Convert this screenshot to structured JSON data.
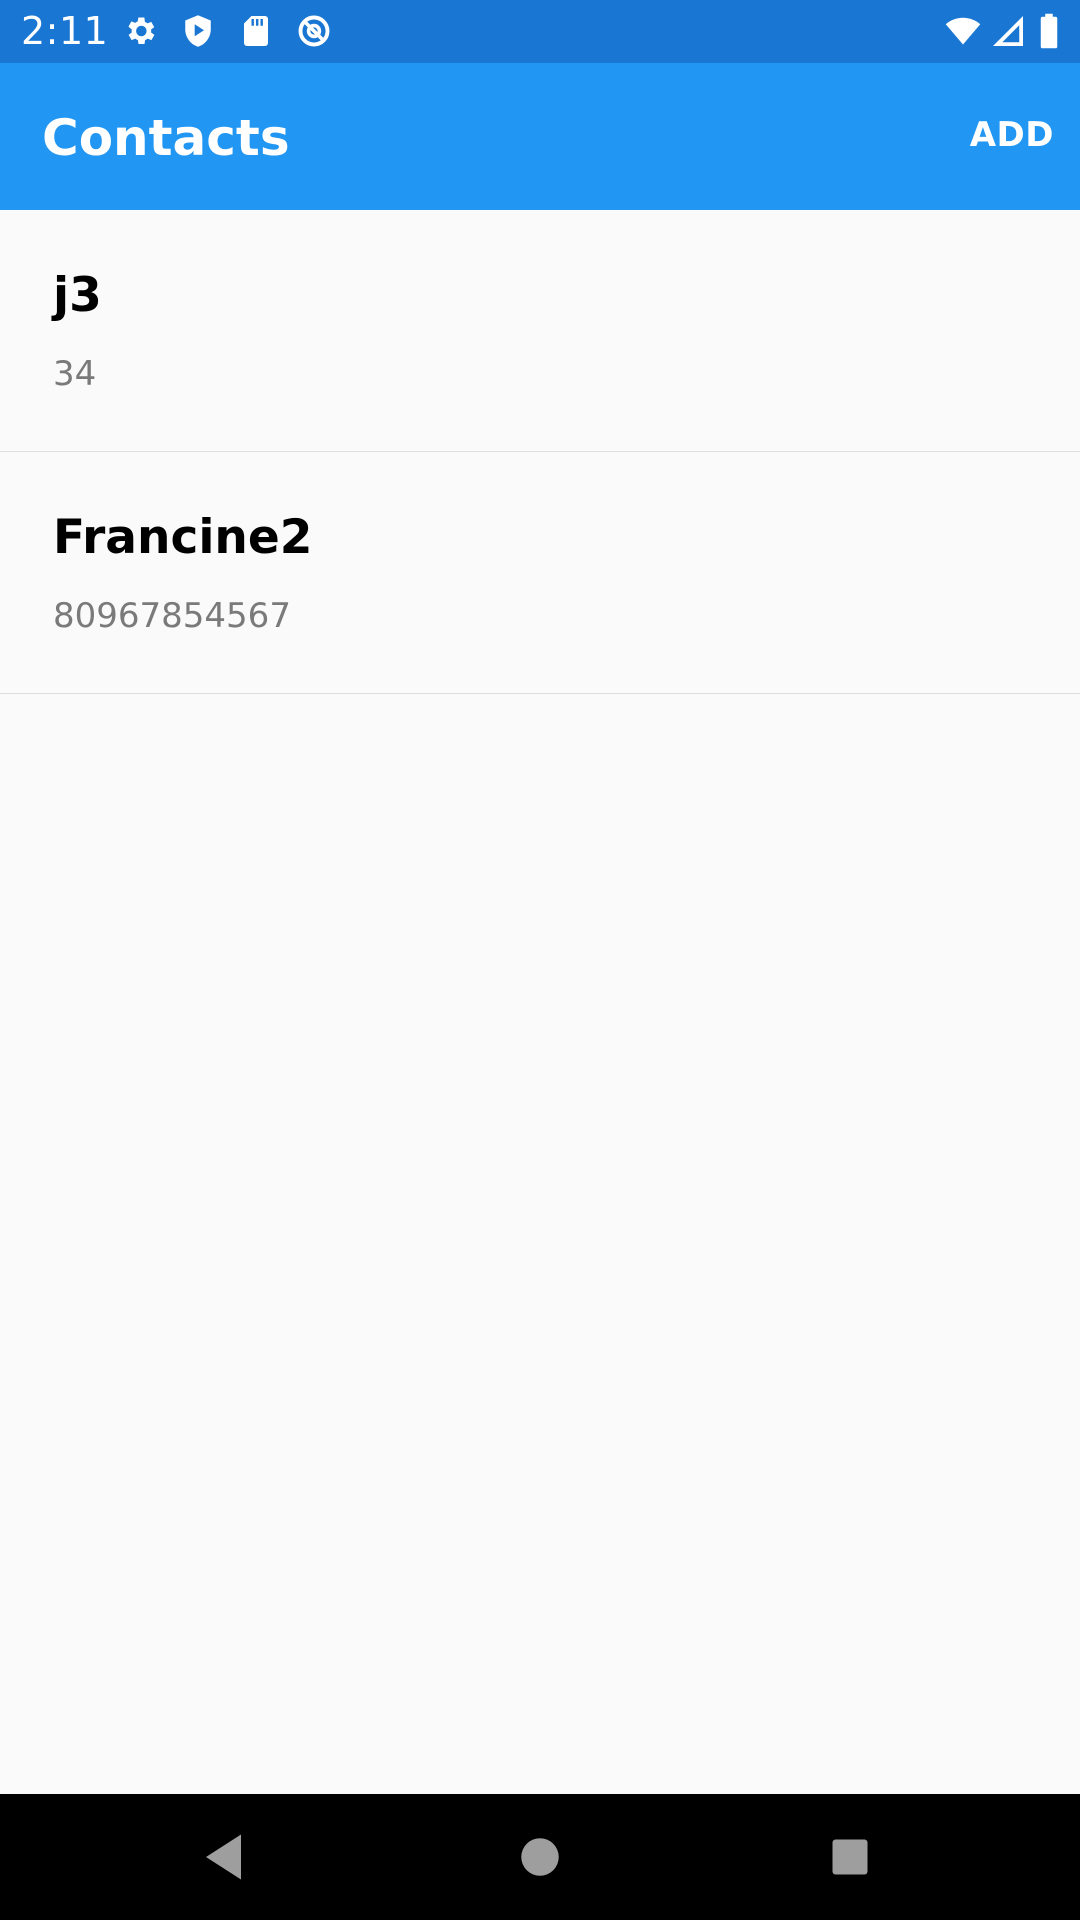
{
  "status_bar": {
    "time": "2:11",
    "left_icons": [
      "gear-icon",
      "shield-play-icon",
      "sd-card-icon",
      "at-sign-icon"
    ],
    "right_icons": [
      "wifi-icon",
      "cell-signal-icon",
      "battery-icon"
    ]
  },
  "app_bar": {
    "title": "Contacts",
    "add_label": "ADD",
    "color": "#2196F3"
  },
  "contacts": [
    {
      "name": "j3",
      "phone": "34"
    },
    {
      "name": "Francine2",
      "phone": "80967854567"
    }
  ],
  "nav_bar": {
    "buttons": [
      "back-icon",
      "home-icon",
      "recents-icon"
    ]
  },
  "colors": {
    "status_bar": "#1976D2",
    "app_bar": "#2196F3",
    "background": "#FAFAFA",
    "secondary_text": "#7A7A7A"
  }
}
